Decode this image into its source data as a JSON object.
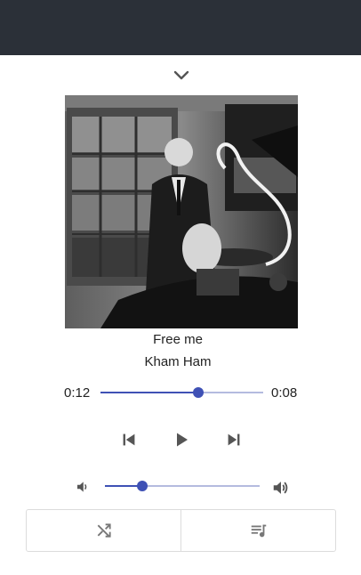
{
  "header": {
    "collapse_icon": "chevron-down-icon"
  },
  "album_art": {
    "description_icon": "album-art-image"
  },
  "track": {
    "title": "Free me",
    "artist": "Kham Ham"
  },
  "progress": {
    "elapsed": "0:12",
    "remaining": "0:08",
    "fraction": 0.6
  },
  "controls": {
    "previous_icon": "skip-previous-icon",
    "play_icon": "play-icon",
    "next_icon": "skip-next-icon"
  },
  "volume": {
    "low_icon": "volume-down-icon",
    "high_icon": "volume-up-icon",
    "fraction": 0.24
  },
  "bottom_actions": {
    "shuffle_icon": "shuffle-icon",
    "queue_icon": "playlist-icon"
  },
  "colors": {
    "accent": "#3f51b5",
    "accent_light": "#b4bbdf",
    "topbar": "#2b3038",
    "icon": "#555555"
  }
}
